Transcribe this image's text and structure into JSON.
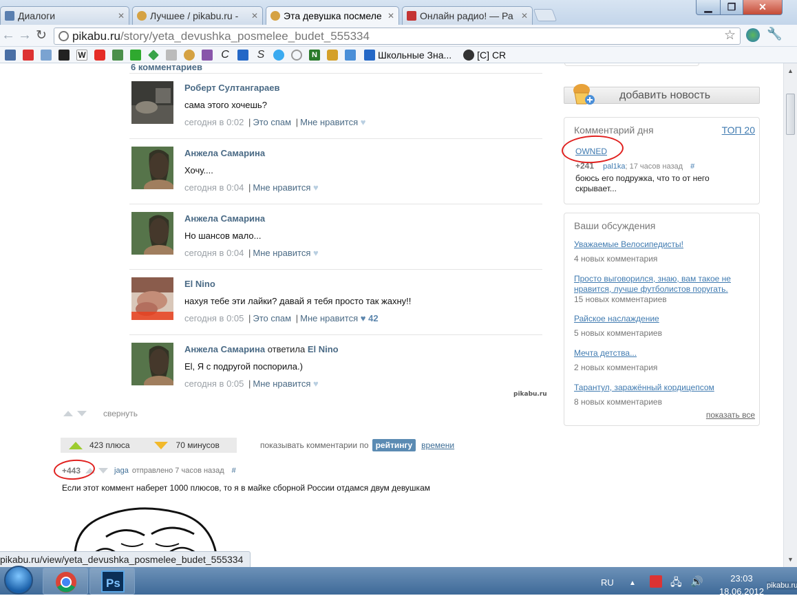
{
  "browser": {
    "tabs": [
      {
        "title": "Диалоги",
        "active": false,
        "color": "#5a7fb0"
      },
      {
        "title": "Лучшее / pikabu.ru - ",
        "active": false,
        "color": "#d5a243"
      },
      {
        "title": "Эта девушка посмеле",
        "active": true,
        "color": "#d5a243"
      },
      {
        "title": "Онлайн радио! — Ра",
        "active": false,
        "color": "#c43434"
      }
    ],
    "url_host": "pikabu.ru",
    "url_path": "/story/yeta_devushka_posmelee_budet_555334",
    "bookmarks_label_1": "Школьные Зна...",
    "bookmarks_label_2": "[C] CR"
  },
  "comments": {
    "header": "6 комментариев",
    "items": [
      {
        "author": "Роберт Султангараев",
        "text": "сама этого хочешь?",
        "time": "сегодня в 0:02",
        "spam": "Это спам",
        "like": "Мне нравится",
        "count": ""
      },
      {
        "author": "Анжела Самарина",
        "text": "Хочу....",
        "time": "сегодня в 0:04",
        "like": "Мне нравится",
        "count": ""
      },
      {
        "author": "Анжела Самарина",
        "text": "Но шансов мало...",
        "time": "сегодня в 0:04",
        "like": "Мне нравится",
        "count": ""
      },
      {
        "author": "El Nino",
        "text": "нахуя тебе эти лайки? давай я тебя просто так жахну!!",
        "time": "сегодня в 0:05",
        "spam": "Это спам",
        "like": "Мне нравится",
        "count": "42"
      },
      {
        "author": "Анжела Самарина",
        "reply_word": "ответила",
        "reply_to": "El Nino",
        "text": "El, Я с подругой поспорила.)",
        "time": "сегодня в 0:05",
        "like": "Мне нравится",
        "count": ""
      }
    ],
    "watermark": "pikabu.ru",
    "collapse": "свернуть"
  },
  "rating": {
    "plus": "423 плюса",
    "minus": "70 минусов",
    "sort_label": "показывать комментарии по",
    "sort_active": "рейтингу",
    "sort_other": "времени"
  },
  "post_comment": {
    "score": "+443",
    "user": "jaga",
    "meta": "отправлено 7 часов назад",
    "hash": "#",
    "text": "Если этот коммент наберет 1000 плюсов, то я в майке сборной России отдамся двум девушкам"
  },
  "sidebar": {
    "add_news": "добавить новость",
    "comment_of_day": {
      "title": "Комментарий дня",
      "top": "ТОП 20",
      "link": "OWNED",
      "score": "+241",
      "user": "pal1ka",
      "time": "; 17 часов назад",
      "hash": "#",
      "text": "боюсь его подружка, что то от него скрывает..."
    },
    "discussions": {
      "title": "Ваши обсуждения",
      "items": [
        {
          "title": "Уважаемые Велосипедисты!",
          "count": "4 новых комментария"
        },
        {
          "title": "Просто выговорился, знаю, вам такое не нравится, лучше футболистов поругать.",
          "count": "15 новых комментариев"
        },
        {
          "title": "Райское наслаждение",
          "count": "5 новых комментариев"
        },
        {
          "title": "Мечта детства...",
          "count": "2 новых комментария"
        },
        {
          "title": "Тарантул, заражённый кордицепсом",
          "count": "8 новых комментариев"
        }
      ],
      "show_all": "показать все"
    }
  },
  "status_url": "pikabu.ru/view/yeta_devushka_posmelee_budet_555334",
  "taskbar": {
    "lang": "RU",
    "time": "23:03",
    "date": "18.06.2012",
    "watermark": "pikabu.ru"
  }
}
